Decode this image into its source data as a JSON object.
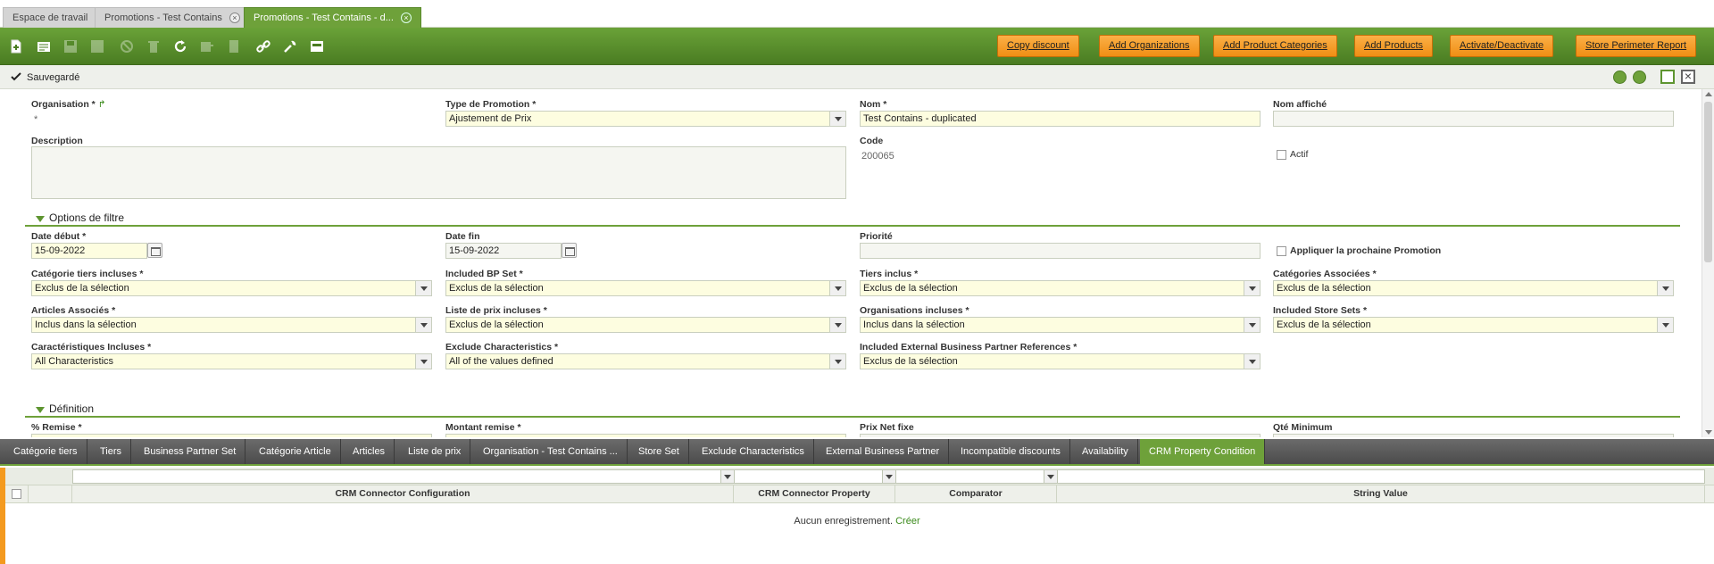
{
  "window_tabs": [
    {
      "label": "Espace de travail",
      "closable": false
    },
    {
      "label": "Promotions - Test Contains",
      "closable": true
    },
    {
      "label": "Promotions - Test Contains - d...",
      "closable": true,
      "active": true
    }
  ],
  "toolbar": {
    "icons": [
      "new-record-icon",
      "new-form-icon",
      "save-icon",
      "save-close-icon",
      "undo-icon",
      "delete-icon",
      "refresh-icon",
      "export-icon",
      "attachment-icon",
      "link-icon",
      "tools-icon",
      "layout-icon"
    ],
    "actions": [
      "Copy discount",
      "Add Organizations",
      "Add Product Categories",
      "Add Products",
      "Activate/Deactivate",
      "Store Perimeter Report"
    ]
  },
  "status": {
    "label": "Sauvegardé"
  },
  "form": {
    "organisation": {
      "label": "Organisation *",
      "value": "*"
    },
    "type_promotion": {
      "label": "Type de Promotion *",
      "value": "Ajustement de Prix"
    },
    "nom": {
      "label": "Nom *",
      "value": "Test Contains - duplicated"
    },
    "nom_affiche": {
      "label": "Nom affiché",
      "value": ""
    },
    "description": {
      "label": "Description",
      "value": ""
    },
    "code": {
      "label": "Code",
      "value": "200065"
    },
    "actif": {
      "label": "Actif",
      "checked": false
    },
    "section_filtre": "Options de filtre",
    "date_debut": {
      "label": "Date début *",
      "value": "15-09-2022"
    },
    "date_fin": {
      "label": "Date fin",
      "value": "15-09-2022"
    },
    "priorite": {
      "label": "Priorité",
      "value": ""
    },
    "appliquer": {
      "label": "Appliquer la prochaine Promotion",
      "checked": false
    },
    "cat_tiers": {
      "label": "Catégorie tiers incluses *",
      "value": "Exclus de la sélection"
    },
    "included_bp_set": {
      "label": "Included BP Set *",
      "value": "Exclus de la sélection"
    },
    "tiers_inclus": {
      "label": "Tiers inclus *",
      "value": "Exclus de la sélection"
    },
    "cat_associees": {
      "label": "Catégories Associées *",
      "value": "Exclus de la sélection"
    },
    "articles_associes": {
      "label": "Articles Associés *",
      "value": "Inclus dans la sélection"
    },
    "liste_prix": {
      "label": "Liste de prix incluses *",
      "value": "Exclus de la sélection"
    },
    "organisations_incluses": {
      "label": "Organisations incluses *",
      "value": "Inclus dans la sélection"
    },
    "included_store_sets": {
      "label": "Included Store Sets *",
      "value": "Exclus de la sélection"
    },
    "caracteristiques": {
      "label": "Caractéristiques Incluses *",
      "value": "All Characteristics"
    },
    "exclude_characteristics": {
      "label": "Exclude Characteristics *",
      "value": "All of the values defined"
    },
    "ext_bp_refs": {
      "label": "Included External Business Partner References *",
      "value": "Exclus de la sélection"
    },
    "section_definition": "Définition",
    "remise": {
      "label": "% Remise *"
    },
    "montant_remise": {
      "label": "Montant remise *"
    },
    "prix_net": {
      "label": "Prix Net fixe"
    },
    "qte_min": {
      "label": "Qté Minimum"
    }
  },
  "sub_tabs": [
    "Catégorie tiers",
    "Tiers",
    "Business Partner Set",
    "Catégorie Article",
    "Articles",
    "Liste de prix",
    "Organisation - Test Contains ...",
    "Store Set",
    "Exclude Characteristics",
    "External Business Partner",
    "Incompatible discounts",
    "Availability",
    "CRM Property Condition"
  ],
  "grid": {
    "columns": [
      "CRM Connector Configuration",
      "CRM Connector Property",
      "Comparator",
      "String Value"
    ],
    "empty_text": "Aucun enregistrement.",
    "create_link": "Créer"
  }
}
